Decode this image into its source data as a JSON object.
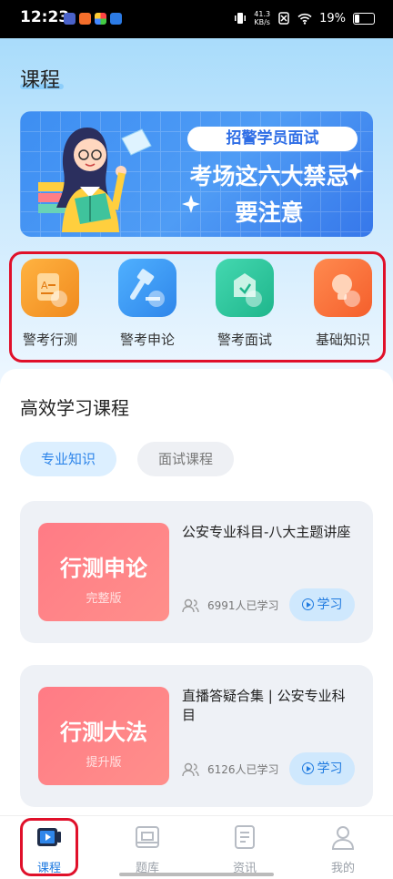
{
  "status": {
    "time": "12:23",
    "net_speed": "41.3",
    "net_unit": "KB/s",
    "battery": "19%"
  },
  "page": {
    "title": "课程"
  },
  "banner": {
    "tag": "招警学员面试",
    "line1": "考场这六大禁忌",
    "line2": "要注意"
  },
  "quick_actions": [
    {
      "label": "警考行测",
      "icon": "document-a-icon",
      "color": "#f7a12f"
    },
    {
      "label": "警考申论",
      "icon": "gavel-icon",
      "color": "#3c9df5"
    },
    {
      "label": "警考面试",
      "icon": "interview-pen-icon",
      "color": "#2fc9a0"
    },
    {
      "label": "基础知识",
      "icon": "lightbulb-icon",
      "color": "#fb6b3a"
    }
  ],
  "section": {
    "title": "高效学习课程"
  },
  "filters": {
    "active": "专业知识",
    "inactive": "面试课程"
  },
  "courses": [
    {
      "thumb_title": "行测申论",
      "thumb_sub": "完整版",
      "title": "公安专业科目-八大主题讲座",
      "learners": "6991人已学习",
      "action": "学习"
    },
    {
      "thumb_title": "行测大法",
      "thumb_sub": "提升版",
      "title": "直播答疑合集 | 公安专业科目",
      "learners": "6126人已学习",
      "action": "学习"
    }
  ],
  "tabs": [
    {
      "label": "课程",
      "icon": "course-play-icon",
      "active": true
    },
    {
      "label": "题库",
      "icon": "question-bank-icon",
      "active": false
    },
    {
      "label": "资讯",
      "icon": "news-icon",
      "active": false
    },
    {
      "label": "我的",
      "icon": "profile-icon",
      "active": false
    }
  ],
  "colors": {
    "accent": "#1f7ae0",
    "highlight_box": "#e0102a"
  }
}
